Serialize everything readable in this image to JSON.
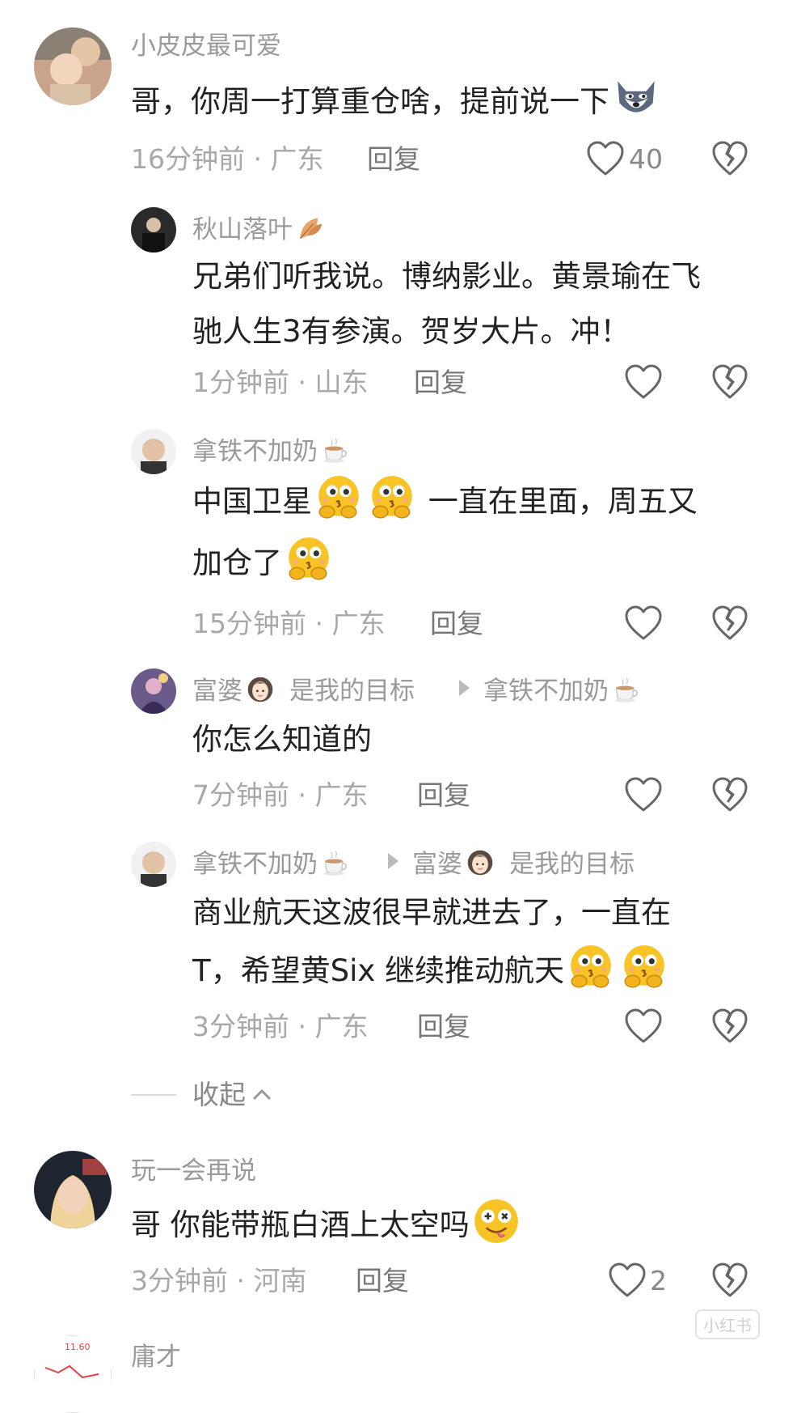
{
  "comments": [
    {
      "user": "小皮皮最可爱",
      "text": "哥，你周一打算重仓啥，提前说一下",
      "time": "16分钟前",
      "location": "广东",
      "reply_label": "回复",
      "likes": "40",
      "replies": [
        {
          "user": "秋山落叶",
          "text_line1": "兄弟们听我说。博纳影业。黄景瑜在飞",
          "text_line2": "驰人生3有参演。贺岁大片。冲！",
          "time": "1分钟前",
          "location": "山东",
          "reply_label": "回复"
        },
        {
          "user": "拿铁不加奶",
          "text_line1_a": "中国卫星",
          "text_line1_b": "一直在里面，周五又",
          "text_line2": "加仓了",
          "time": "15分钟前",
          "location": "广东",
          "reply_label": "回复"
        },
        {
          "user": "富婆",
          "user_suffix": "是我的目标",
          "reply_to": "拿铁不加奶",
          "text": "你怎么知道的",
          "time": "7分钟前",
          "location": "广东",
          "reply_label": "回复"
        },
        {
          "user": "拿铁不加奶",
          "reply_to": "富婆",
          "reply_to_suffix": "是我的目标",
          "text_line1": "商业航天这波很早就进去了，一直在",
          "text_line2": "T，希望黄Six 继续推动航天",
          "time": "3分钟前",
          "location": "广东",
          "reply_label": "回复"
        }
      ],
      "collapse_label": "收起"
    },
    {
      "user": "玩一会再说",
      "text": "哥 你能带瓶白酒上太空吗",
      "time": "3分钟前",
      "location": "河南",
      "reply_label": "回复",
      "likes": "2"
    },
    {
      "user": "庸才"
    }
  ],
  "separator": "·",
  "watermark": "小红书",
  "colors": {
    "text": "#222222",
    "meta": "#a8a8a8",
    "username": "#9a9a9a",
    "emoji": "#f7c325"
  }
}
